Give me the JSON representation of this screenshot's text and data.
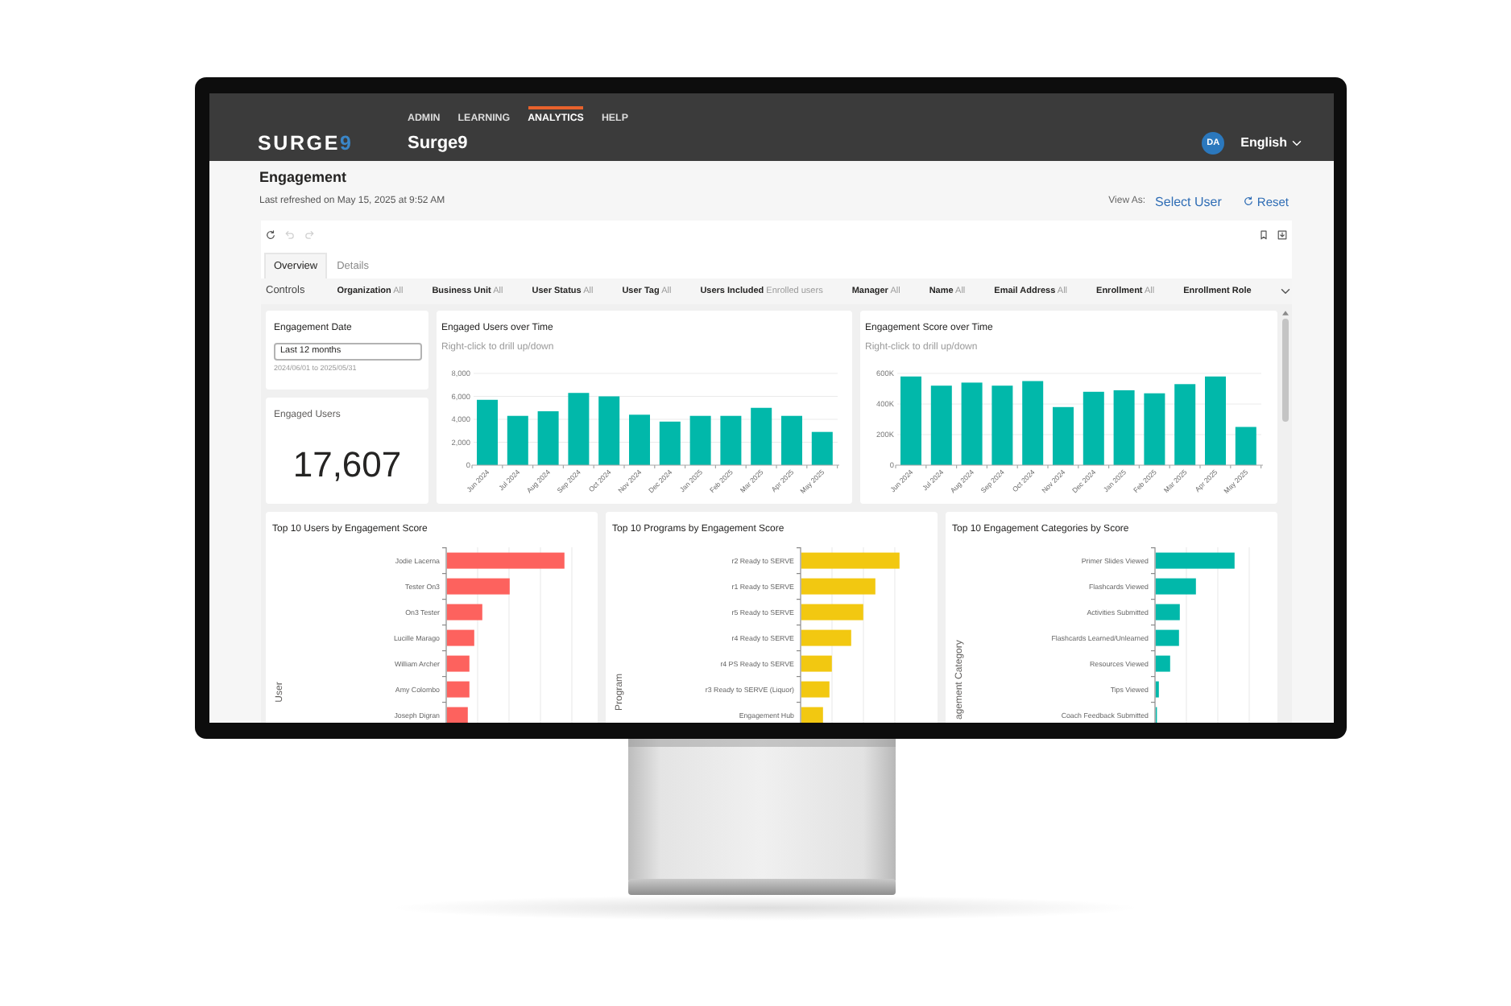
{
  "header": {
    "logo": {
      "text": "SURGE",
      "accent": "9"
    },
    "nav": [
      {
        "label": "ADMIN",
        "selected": false
      },
      {
        "label": "LEARNING",
        "selected": false
      },
      {
        "label": "ANALYTICS",
        "selected": true
      },
      {
        "label": "HELP",
        "selected": false
      }
    ],
    "site_name": "Surge9",
    "avatar": "DA",
    "language": "English"
  },
  "heading": {
    "title": "Engagement",
    "last_refreshed": "Last refreshed on May 15, 2025 at 9:52 AM",
    "view_as": {
      "label": "View As:",
      "value": "Select User"
    },
    "reset": "Reset"
  },
  "report": {
    "toolbar": {
      "left": [
        {
          "kind": "reset",
          "disabled": false
        },
        {
          "kind": "undo",
          "disabled": true
        },
        {
          "kind": "redo",
          "disabled": true
        }
      ],
      "right": [
        {
          "kind": "bookmark"
        },
        {
          "kind": "export"
        }
      ]
    },
    "tabs": [
      {
        "label": "Overview",
        "selected": true
      },
      {
        "label": "Details",
        "selected": false
      }
    ],
    "filters": {
      "label": "Controls",
      "items": [
        {
          "name": "Organization",
          "value": "All"
        },
        {
          "name": "Business Unit",
          "value": "All"
        },
        {
          "name": "User Status",
          "value": "All"
        },
        {
          "name": "User Tag",
          "value": "All"
        },
        {
          "name": "Users Included",
          "value": "Enrolled users"
        },
        {
          "name": "Manager",
          "value": "All"
        },
        {
          "name": "Name",
          "value": "All"
        },
        {
          "name": "Email Address",
          "value": "All"
        },
        {
          "name": "Enrollment",
          "value": "All"
        },
        {
          "name": "Enrollment Role"
        }
      ]
    },
    "date_filter": {
      "label": "Engagement Date",
      "value": "Last 12 months",
      "range": "2024/06/01 to 2025/05/31"
    },
    "kpi": {
      "label": "Engaged Users",
      "value": "17,607"
    },
    "time_charts": [
      {
        "subtitle": "Right-click to drill up/down",
        "chart_data": {
          "type": "bar",
          "title": "Engaged Users over Time",
          "categories": [
            "Jun 2024",
            "Jul 2024",
            "Aug 2024",
            "Sep 2024",
            "Oct 2024",
            "Nov 2024",
            "Dec 2024",
            "Jan 2025",
            "Feb 2025",
            "Mar 2025",
            "Apr 2025",
            "May 2025"
          ],
          "series": [
            {
              "color": "#01b8aa",
              "values": [
                5700,
                4300,
                4700,
                6300,
                6000,
                4400,
                3800,
                4300,
                4300,
                5000,
                4300,
                2900
              ]
            }
          ],
          "ylim": [
            0,
            8000
          ],
          "yticks": [
            {
              "value": 0,
              "label": "0"
            },
            {
              "value": 2000,
              "label": "2,000"
            },
            {
              "value": 4000,
              "label": "4,000"
            },
            {
              "value": 6000,
              "label": "6,000"
            },
            {
              "value": 8000,
              "label": "8,000"
            }
          ],
          "grid": true
        }
      },
      {
        "subtitle": "Right-click to drill up/down",
        "chart_data": {
          "type": "bar",
          "title": "Engagement Score over Time",
          "categories": [
            "Jun 2024",
            "Jul 2024",
            "Aug 2024",
            "Sep 2024",
            "Oct 2024",
            "Nov 2024",
            "Dec 2024",
            "Jan 2025",
            "Feb 2025",
            "Mar 2025",
            "Apr 2025",
            "May 2025"
          ],
          "series": [
            {
              "color": "#01b8aa",
              "values": [
                580000,
                520000,
                540000,
                520000,
                550000,
                380000,
                480000,
                490000,
                470000,
                530000,
                580000,
                250000
              ]
            }
          ],
          "ylim": [
            0,
            600000
          ],
          "yticks": [
            {
              "value": 0,
              "label": "0"
            },
            {
              "value": 200000,
              "label": "200K"
            },
            {
              "value": 400000,
              "label": "400K"
            },
            {
              "value": 600000,
              "label": "600K"
            }
          ],
          "grid": true
        }
      }
    ],
    "ranking_charts": [
      {
        "title": "Top 10 Users by Engagement Score",
        "axis_title": "User",
        "color": "#fd625e",
        "categories": [
          "Jodie Lacerna",
          "Tester On3",
          "On3 Tester",
          "Lucille Marago",
          "William Archer",
          "Amy Colombo",
          "Joseph Digran"
        ]
      },
      {
        "title": "Top 10 Programs by Engagement Score",
        "axis_title": "Program",
        "color": "#f2c811",
        "categories": [
          "r2 Ready to SERVE",
          "r1 Ready to SERVE",
          "r5 Ready to SERVE",
          "r4 Ready to SERVE",
          "r4 PS Ready to SERVE",
          "r3 Ready to SERVE (Liquor)",
          "Engagement Hub"
        ]
      },
      {
        "title": "Top 10 Engagement Categories by Score",
        "axis_title": "agement Category",
        "color": "#01b8aa",
        "categories": [
          "Primer Slides Viewed",
          "Flashcards Viewed",
          "Activities Submitted",
          "Flashcards Learned/Unlearned",
          "Resources Viewed",
          "Tips Viewed",
          "Coach Feedback Submitted"
        ]
      }
    ]
  }
}
